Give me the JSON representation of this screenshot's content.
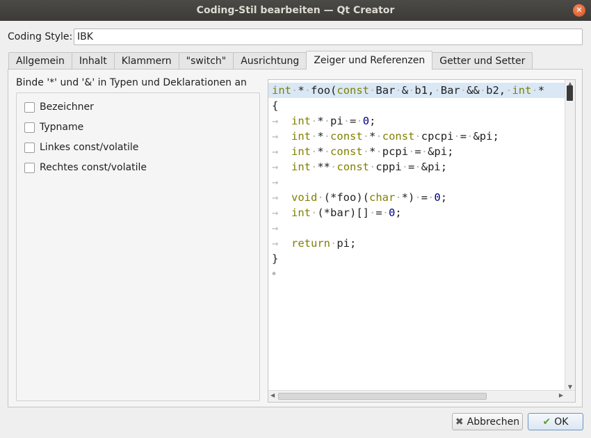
{
  "window": {
    "title": "Coding-Stil bearbeiten — Qt Creator",
    "close_glyph": "✕"
  },
  "coding_style": {
    "label": "Coding Style:",
    "value": "IBK"
  },
  "tabs": [
    "Allgemein",
    "Inhalt",
    "Klammern",
    "\"switch\"",
    "Ausrichtung",
    "Zeiger und Referenzen",
    "Getter und Setter"
  ],
  "active_tab": "Zeiger und Referenzen",
  "bind_group": {
    "title": "Binde '*' und '&' in Typen und Deklarationen an",
    "checkboxes": [
      {
        "label": "Bezeichner",
        "checked": false
      },
      {
        "label": "Typname",
        "checked": false
      },
      {
        "label": "Linkes const/volatile",
        "checked": false
      },
      {
        "label": "Rechtes const/volatile",
        "checked": false
      }
    ]
  },
  "code_preview": {
    "lines": [
      "int * foo(const Bar & b1, Bar && b2, int *",
      "{",
      "int * pi = 0;",
      "int * const * const cpcpi = &pi;",
      "int * const * pcpi = &pi;",
      "int ** const cppi = &pi;",
      "",
      "void (*foo)(char *) = 0;",
      "int (*bar)[] = 0;",
      "",
      "return pi;",
      "}"
    ]
  },
  "buttons": {
    "cancel": "Abbrechen",
    "ok": "OK"
  },
  "colors": {
    "keyword": "#808000",
    "number": "#000080",
    "current_line": "#d9e8f4"
  }
}
